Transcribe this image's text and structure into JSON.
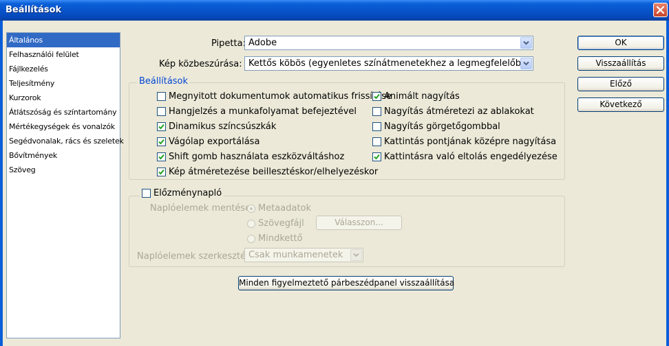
{
  "window": {
    "title": "Beállítások"
  },
  "sidebar": {
    "items": [
      {
        "label": "Általános",
        "selected": true
      },
      {
        "label": "Felhasználói felület"
      },
      {
        "label": "Fájlkezelés"
      },
      {
        "label": "Teljesítmény"
      },
      {
        "label": "Kurzorok"
      },
      {
        "label": "Átlátszóság és színtartomány"
      },
      {
        "label": "Mértékegységek és vonalzók"
      },
      {
        "label": "Segédvonalak, rács és szeletek"
      },
      {
        "label": "Bővítmények"
      },
      {
        "label": "Szöveg"
      }
    ]
  },
  "fields": {
    "pipetta_label": "Pipetta:",
    "pipetta_value": "Adobe",
    "interp_label": "Kép közbeszúrása:",
    "interp_value": "Kettős köbös (egyenletes színátmenetekhez a legmegfelelőbb)"
  },
  "options": {
    "legend": "Beállítások",
    "left": [
      {
        "label": "Megnyitott dokumentumok automatikus frissítése",
        "checked": false
      },
      {
        "label": "Hangjelzés a munkafolyamat befejeztével",
        "checked": false
      },
      {
        "label": "Dinamikus színcsúszkák",
        "checked": true
      },
      {
        "label": "Vágólap exportálása",
        "checked": true
      },
      {
        "label": "Shift gomb használata eszközváltáshoz",
        "checked": true
      },
      {
        "label": "Kép átméretezése beillesztéskor/elhelyezéskor",
        "checked": true
      }
    ],
    "right": [
      {
        "label": "Animált nagyítás",
        "checked": true
      },
      {
        "label": "Nagyítás átméretezi az ablakokat",
        "checked": false
      },
      {
        "label": "Nagyítás görgetőgombbal",
        "checked": false
      },
      {
        "label": "Kattintás pontjának középre nagyítása",
        "checked": false
      },
      {
        "label": "Kattintásra való eltolás engedélyezése",
        "checked": true
      }
    ]
  },
  "history": {
    "legend": "Előzménynapló",
    "checked": false,
    "save_label": "Naplóelemek mentése:",
    "radio_metadata": "Metaadatok",
    "radio_textfile": "Szövegfájl",
    "radio_both": "Mindkettő",
    "choose_button": "Válasszon...",
    "edit_label": "Naplóelemek szerkesztése:",
    "edit_value": "Csak munkamenetek"
  },
  "reset_dialogs_button": "Minden figyelmeztető párbeszédpanel visszaállítása",
  "buttons": {
    "ok": "OK",
    "reset": "Visszaállítás",
    "prev": "Előző",
    "next": "Következő"
  },
  "colors": {
    "titlebar": "#0a5fd8",
    "selection": "#316ac5",
    "dialog_bg": "#ece9d8",
    "check": "#21a121"
  }
}
